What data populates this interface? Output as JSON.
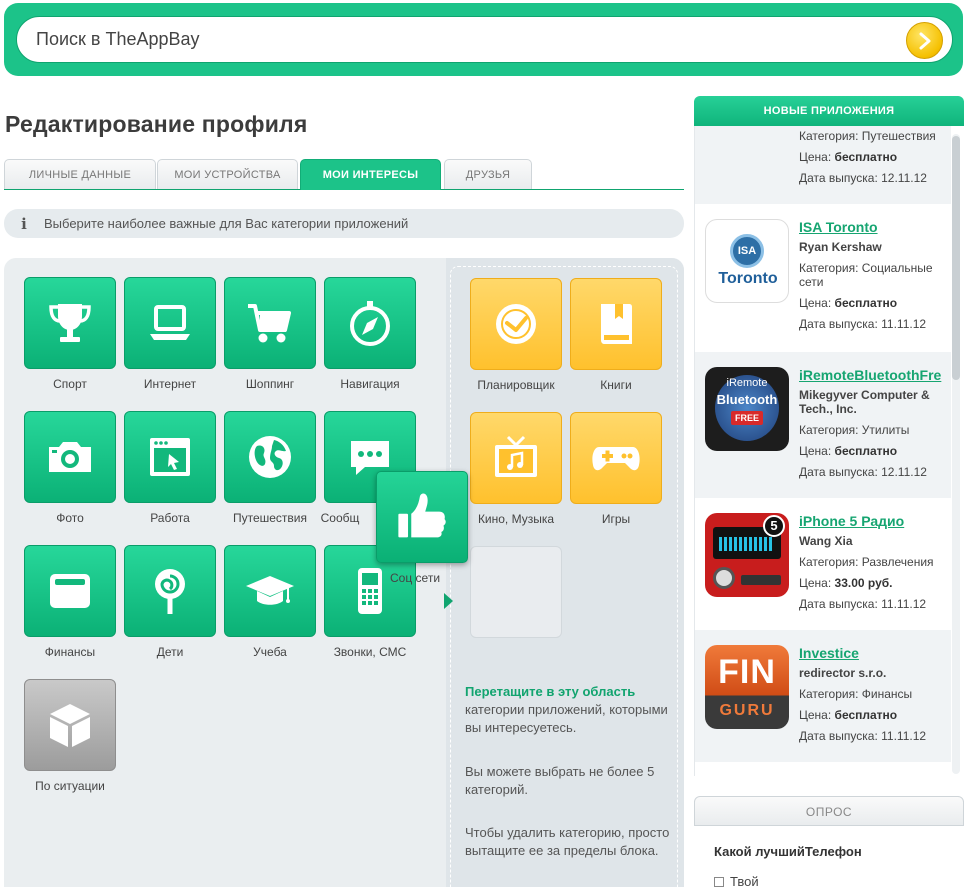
{
  "search": {
    "placeholder": "Поиск в TheAppBay"
  },
  "page": {
    "title": "Редактирование профиля"
  },
  "tabs": [
    {
      "label": "Личные данные"
    },
    {
      "label": "Мои устройства"
    },
    {
      "label": "Мои интересы"
    },
    {
      "label": "Друзья"
    }
  ],
  "info": {
    "text": "Выберите наиболее важные для Вас категории приложений"
  },
  "categories": [
    {
      "label": "Спорт",
      "icon": "trophy-icon"
    },
    {
      "label": "Интернет",
      "icon": "laptop-icon"
    },
    {
      "label": "Шоппинг",
      "icon": "cart-icon"
    },
    {
      "label": "Навигация",
      "icon": "compass-icon"
    },
    {
      "label": "Фото",
      "icon": "camera-icon"
    },
    {
      "label": "Работа",
      "icon": "window-icon"
    },
    {
      "label": "Путешествия",
      "icon": "globe-icon"
    },
    {
      "label": "Сообщ",
      "icon": "chat-icon"
    },
    {
      "label": "Финансы",
      "icon": "wallet-icon"
    },
    {
      "label": "Дети",
      "icon": "lollipop-icon"
    },
    {
      "label": "Учеба",
      "icon": "graduation-cap-icon"
    },
    {
      "label": "Звонки, СМС",
      "icon": "phone-icon"
    },
    {
      "label": "По ситуации",
      "icon": "cube-icon"
    }
  ],
  "dragging": {
    "label": "Соц сети",
    "icon": "thumbs-up-icon"
  },
  "selected": [
    {
      "label": "Планировщик",
      "icon": "clock-icon"
    },
    {
      "label": "Книги",
      "icon": "book-icon"
    },
    {
      "label": "Кино, Музыка",
      "icon": "tv-music-icon"
    },
    {
      "label": "Игры",
      "icon": "gamepad-icon"
    }
  ],
  "help": {
    "drag_title": "Перетащите в эту область",
    "drag_text": "категории приложений, которыми вы интересуетесь.",
    "limit_text": "Вы можете выбрать не более 5 категорий.",
    "remove_text": "Чтобы удалить категорию, просто вытащите ее за пределы блока."
  },
  "sidebar": {
    "title": "Новые приложения",
    "partial": {
      "category": "Категория: Путешествия",
      "price_label": "Цена: ",
      "price": "бесплатно",
      "date": "Дата выпуска: 12.11.12"
    },
    "apps": [
      {
        "name": "ISA Toronto",
        "developer": "Ryan Kershaw",
        "category": "Категория: Социальные сети",
        "price_label": "Цена: ",
        "price": "бесплатно",
        "date": "Дата выпуска: 11.11.12",
        "icon_text_top": "ISA",
        "icon_text": "Toronto"
      },
      {
        "name": "iRemoteBluetoothFre",
        "developer": "Mikegyver Computer & Tech., Inc.",
        "category": "Категория: Утилиты",
        "price_label": "Цена: ",
        "price": "бесплатно",
        "date": "Дата выпуска: 12.11.12",
        "icon_text_top": "iRemote",
        "icon_text": "Bluetooth",
        "icon_text_bottom": "FREE"
      },
      {
        "name": "iPhone 5 Радио",
        "developer": "Wang Xia",
        "category": "Категория: Развлечения",
        "price_label": "Цена: ",
        "price": "33.00 руб.",
        "date": "Дата выпуска: 11.11.12",
        "icon_text": "5"
      },
      {
        "name": "Investice",
        "developer": "redirector s.r.o.",
        "category": "Категория: Финансы",
        "price_label": "Цена: ",
        "price": "бесплатно",
        "date": "Дата выпуска: 11.11.12",
        "icon_text": "FIN",
        "icon_text_bottom": "GURU"
      }
    ]
  },
  "poll": {
    "title": "Опрос",
    "question": "Какой лучшийТелефон",
    "option": "Твой"
  },
  "colors": {
    "accent": "#1cc389",
    "accent_dark": "#0fa46f",
    "yellow": "#ffc12d",
    "link": "#16a571"
  }
}
